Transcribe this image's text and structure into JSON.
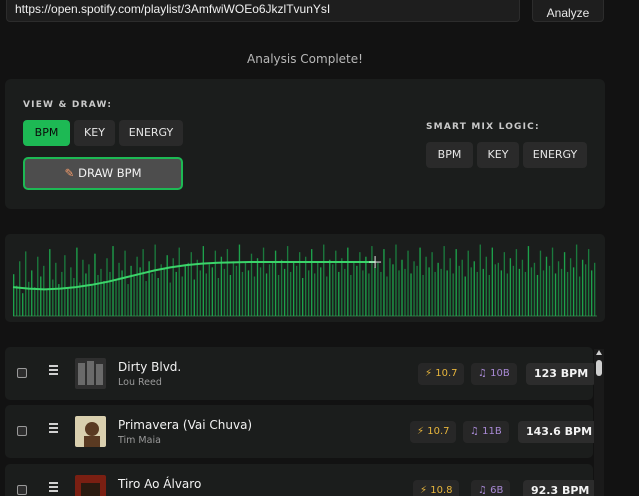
{
  "url_input": {
    "value": "https://open.spotify.com/playlist/3AmfwiWOEo6JkzlTvunYsI"
  },
  "analyze_label": "Analyze",
  "status_text": "Analysis Complete!",
  "view_draw": {
    "label": "VIEW & DRAW:",
    "buttons": [
      {
        "label": "BPM",
        "active": true
      },
      {
        "label": "KEY",
        "active": false
      },
      {
        "label": "ENERGY",
        "active": false
      }
    ],
    "draw_label": "DRAW BPM",
    "draw_icon": "pencil-icon"
  },
  "smart_mix": {
    "label": "SMART MIX LOGIC:",
    "buttons": [
      {
        "label": "BPM"
      },
      {
        "label": "KEY"
      },
      {
        "label": "ENERGY"
      }
    ]
  },
  "colors": {
    "accent": "#1db954",
    "energy": "#e7b53c",
    "key": "#a98ad6"
  },
  "chart_data": {
    "type": "bar",
    "series": [
      {
        "values": [
          55,
          40,
          72,
          30,
          85,
          45,
          60,
          38,
          78,
          52,
          66,
          34,
          88,
          48,
          70,
          42,
          58,
          80,
          36,
          64,
          50,
          90,
          44,
          74,
          56,
          68,
          40,
          82,
          54,
          62,
          46,
          76,
          58,
          92,
          48,
          70,
          60,
          86,
          42,
          66,
          52,
          78,
          64,
          88,
          46,
          72,
          56,
          94,
          50,
          68,
          62,
          80,
          44,
          76,
          58,
          90,
          52,
          66,
          70,
          84,
          48,
          74,
          60,
          92,
          56,
          68,
          64,
          86,
          50,
          78,
          62,
          88,
          54,
          72,
          66,
          94,
          58,
          70,
          60,
          82,
          52,
          76,
          64,
          90,
          56,
          68,
          70,
          86,
          54,
          74,
          62,
          92,
          58,
          72,
          66,
          84,
          50,
          78,
          60,
          88,
          56,
          70,
          64,
          94,
          52,
          74,
          68,
          86,
          58,
          76,
          62,
          90,
          54,
          72,
          66,
          84,
          60,
          78,
          56,
          92,
          64,
          70,
          58,
          88,
          52,
          76,
          68,
          94,
          60,
          74,
          62,
          86,
          56,
          72,
          66,
          90,
          54,
          78,
          64,
          84,
          58,
          70,
          62,
          92,
          60,
          76,
          56,
          88,
          66,
          74,
          52,
          86,
          64,
          72,
          58,
          94,
          62,
          78,
          54,
          90,
          68,
          70,
          60,
          84,
          56,
          76,
          66,
          88,
          62,
          74,
          58,
          92,
          64,
          70,
          54,
          86,
          60,
          78,
          66,
          90,
          56,
          72,
          62,
          84,
          58,
          76,
          64,
          94,
          52,
          74,
          68,
          88,
          60,
          70
        ]
      },
      {
        "values": [
          38,
          36,
          35,
          36,
          38,
          41,
          45,
          50,
          55,
          60,
          64,
          67,
          69,
          70,
          70.5,
          71,
          71,
          71,
          71,
          71,
          71,
          71,
          71,
          71
        ]
      }
    ],
    "ylim": [
      0,
      100
    ]
  },
  "tracks": [
    {
      "title": "Dirty Blvd.",
      "artist": "Lou Reed",
      "energy": "10.7",
      "key": "10B",
      "bpm": "123 BPM",
      "art": [
        "#2f2f2f",
        "#6a6a6a"
      ]
    },
    {
      "title": "Primavera (Vai Chuva)",
      "artist": "Tim Maia",
      "energy": "10.7",
      "key": "11B",
      "bpm": "143.6 BPM",
      "art": [
        "#d9cfae",
        "#5a3a22"
      ]
    },
    {
      "title": "Tiro Ao Álvaro",
      "artist": "",
      "energy": "10.8",
      "key": "6B",
      "bpm": "92.3 BPM",
      "art": [
        "#7a1f12",
        "#2a1a10"
      ]
    }
  ]
}
